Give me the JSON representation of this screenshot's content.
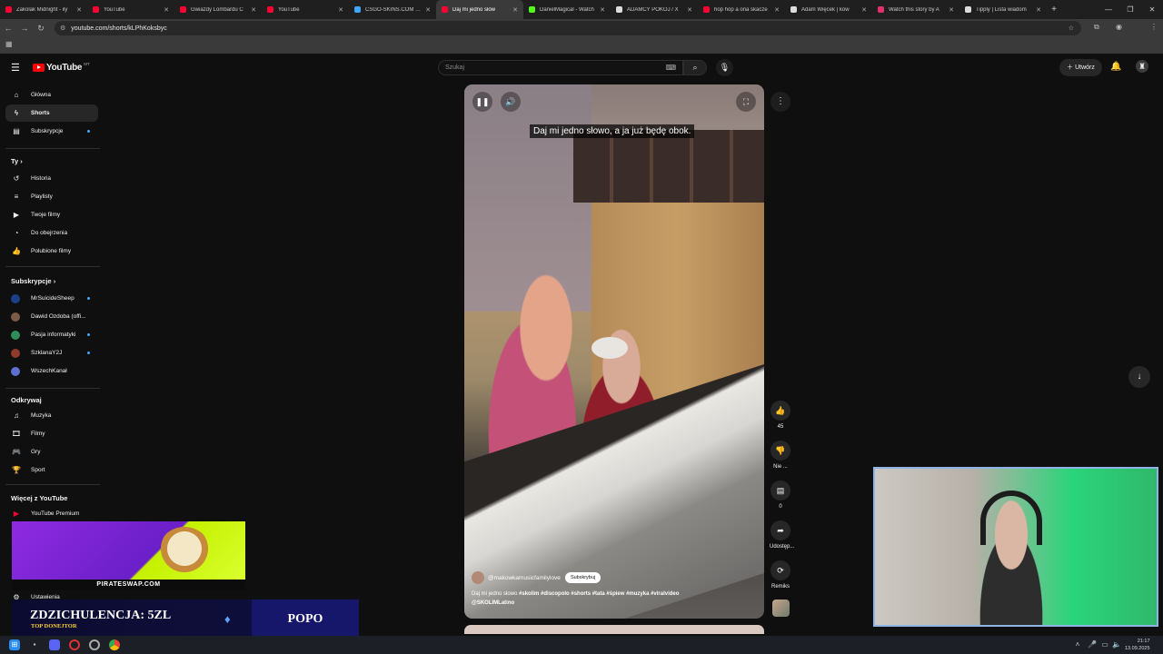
{
  "browser": {
    "tabs": [
      {
        "label": "Zakolak Midnight - ily",
        "color": "#ff0033"
      },
      {
        "label": "YouTube",
        "color": "#ff0033"
      },
      {
        "label": "Gwiazdy Lombardu C",
        "color": "#ff0033"
      },
      {
        "label": "YouTube",
        "color": "#ff0033"
      },
      {
        "label": "CSGO-SKINS.COM - N",
        "color": "#3ea6ff"
      },
      {
        "label": "Daj mi jedno słow",
        "color": "#ff0033",
        "active": true
      },
      {
        "label": "DanielMagical - Watch",
        "color": "#53fc18"
      },
      {
        "label": "ADAMCY POKOJ / X",
        "color": "#dddddd"
      },
      {
        "label": "hop hop a ona skacze",
        "color": "#ff0033"
      },
      {
        "label": "Adam Więcek | ków",
        "color": "#dddddd"
      },
      {
        "label": "Watch this story by A",
        "color": "#e1306c"
      },
      {
        "label": "Tipply | Lista wiadom",
        "color": "#dddddd"
      }
    ],
    "url": "youtube.com/shorts/kLPhKoksbyc"
  },
  "header": {
    "logo_text": "YouTube",
    "region": "MT",
    "search_placeholder": "Szukaj",
    "create_label": "Utwórz"
  },
  "sidebar": {
    "main": [
      {
        "label": "Główna",
        "icon": "home-icon"
      },
      {
        "label": "Shorts",
        "icon": "shorts-icon",
        "active": true
      },
      {
        "label": "Subskrypcje",
        "icon": "subscriptions-icon",
        "dot": true
      }
    ],
    "you_heading": "Ty",
    "you": [
      {
        "label": "Historia",
        "icon": "history-icon"
      },
      {
        "label": "Playlisty",
        "icon": "playlist-icon"
      },
      {
        "label": "Twoje filmy",
        "icon": "video-icon"
      },
      {
        "label": "Do obejrzenia",
        "icon": "clock-icon"
      },
      {
        "label": "Polubione filmy",
        "icon": "like-icon"
      }
    ],
    "subs_heading": "Subskrypcje",
    "subs": [
      {
        "label": "MrSuicideSheep",
        "dot": true,
        "avatar": "#1c3f8a"
      },
      {
        "label": "Dawid Ozdoba (offi...",
        "avatar": "#7a5a48"
      },
      {
        "label": "Pasja informatyki",
        "dot": true,
        "avatar": "#2f8f5a"
      },
      {
        "label": "SzklanaY2J",
        "dot": true,
        "avatar": "#8f3a2a"
      },
      {
        "label": "WszechKanał",
        "avatar": "#5f6fd0"
      }
    ],
    "explore_heading": "Odkrywaj",
    "explore": [
      {
        "label": "Muzyka",
        "icon": "music-icon"
      },
      {
        "label": "Filmy",
        "icon": "film-icon"
      },
      {
        "label": "Gry",
        "icon": "gamepad-icon"
      },
      {
        "label": "Sport",
        "icon": "trophy-icon"
      }
    ],
    "more_heading": "Więcej z YouTube",
    "more": [
      {
        "label": "YouTube Premium",
        "icon": "premium-icon"
      }
    ],
    "settings_label": "Ustawienia"
  },
  "short": {
    "caption": "Daj mi jedno słowo, a ja już będę obok.",
    "channel": "@makowkamusicfamilylove",
    "subscribe_label": "Subskrybuj",
    "description_plain": "Daj mi jedno słowo",
    "description_tags": "#skolim #discopolo #shorts #tata #śpiew #muzyka #viralvideo @SKOLIMLatino"
  },
  "actions": {
    "likes": "45",
    "dislike_label": "Nie ...",
    "comments": "0",
    "share_label": "Udostęp...",
    "remix_label": "Remiks"
  },
  "overlay": {
    "banner_caption": "PIRATESWAP.COM",
    "donor_name": "ZDZICHULENCJA: 5ZL",
    "donor_role": "TOP DONEJTOR",
    "donor_nick": "POPO"
  },
  "taskbar": {
    "time": "21:17",
    "date": "13.09.2025"
  }
}
